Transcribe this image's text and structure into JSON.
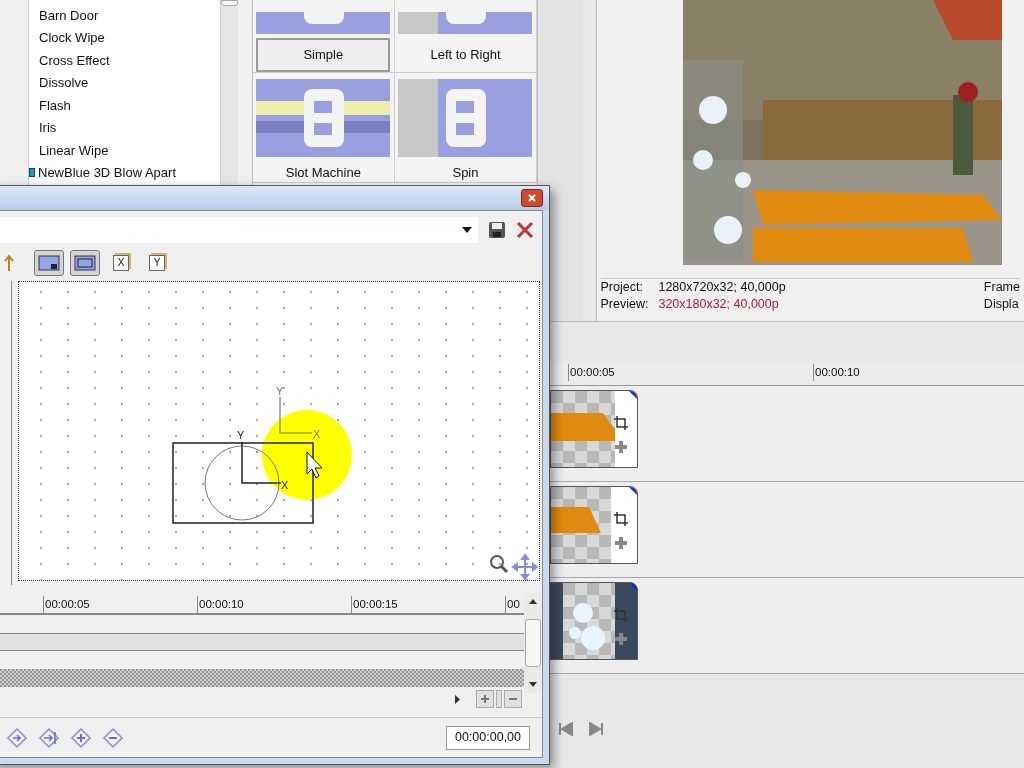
{
  "transitions_list": {
    "items": [
      {
        "label": "Barn Door",
        "kind": "builtin"
      },
      {
        "label": "Clock Wipe",
        "kind": "builtin"
      },
      {
        "label": "Cross Effect",
        "kind": "builtin"
      },
      {
        "label": "Dissolve",
        "kind": "builtin"
      },
      {
        "label": "Flash",
        "kind": "builtin"
      },
      {
        "label": "Iris",
        "kind": "builtin"
      },
      {
        "label": "Linear Wipe",
        "kind": "builtin"
      },
      {
        "label": "NewBlue 3D Blow Apart",
        "kind": "plugin"
      }
    ]
  },
  "presets": [
    {
      "label": "Simple",
      "selected": true
    },
    {
      "label": "Left to Right",
      "selected": false
    },
    {
      "label": "Slot Machine",
      "selected": false
    },
    {
      "label": "Spin",
      "selected": false
    }
  ],
  "preview_info": {
    "project_label": "Project:",
    "project_value": "1280x720x32; 40,000p",
    "preview_label": "Preview:",
    "preview_value": "320x180x32; 40,000p",
    "frame_label": "Frame",
    "display_label": "Displa"
  },
  "timeline": {
    "ruler": [
      "00:00:05",
      "00:00:10"
    ],
    "tracks": [
      {
        "kind": "orange",
        "selected": false
      },
      {
        "kind": "orange-small",
        "selected": false
      },
      {
        "kind": "floral",
        "selected": true
      }
    ]
  },
  "dialog": {
    "toolbar": [
      {
        "kind": "move",
        "selected": false
      },
      {
        "kind": "source",
        "selected": true
      },
      {
        "kind": "fit",
        "selected": true
      },
      {
        "kind": "lock",
        "label": "X",
        "selected": false
      },
      {
        "kind": "lock",
        "label": "Y",
        "selected": false
      }
    ],
    "axis_labels": {
      "outer_y": "Y",
      "outer_x": "X",
      "inner_y": "Y",
      "inner_x": "X"
    },
    "ruler": [
      "00:00:05",
      "00:00:10",
      "00:00:15",
      "00"
    ],
    "time": "00:00:00,00"
  }
}
